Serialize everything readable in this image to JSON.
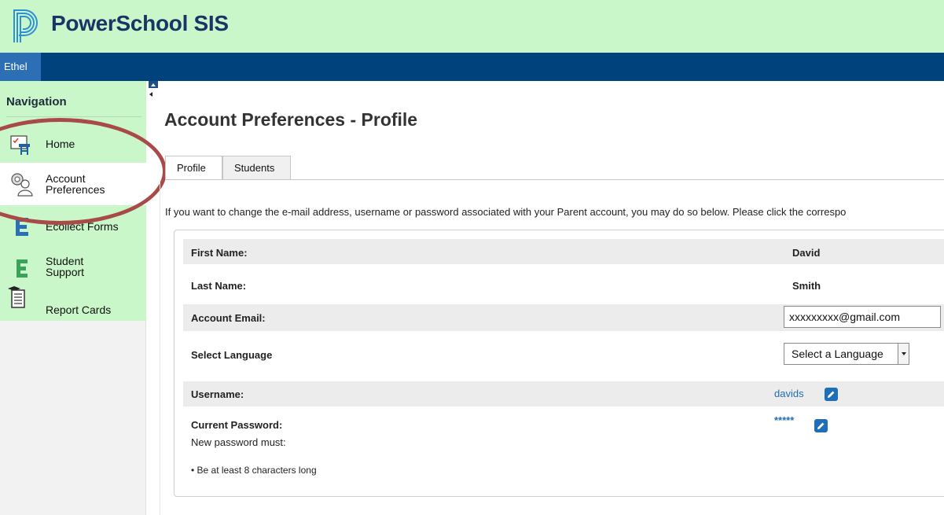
{
  "header": {
    "brand": "PowerSchool SIS"
  },
  "user_bar": {
    "user_name": "Ethel"
  },
  "sidebar": {
    "title": "Navigation",
    "items": [
      {
        "label": "Home",
        "icon": "home-icon"
      },
      {
        "label_line1": "Account",
        "label_line2": "Preferences",
        "icon": "account-preferences-icon",
        "active": true
      },
      {
        "label": "Ecollect Forms",
        "icon": "ecollect-forms-icon"
      },
      {
        "label_line1": "Student",
        "label_line2": "Support",
        "icon": "student-support-icon"
      },
      {
        "label": "Report Cards",
        "icon": "report-cards-icon"
      }
    ]
  },
  "main": {
    "title": "Account Preferences - Profile",
    "tabs": [
      {
        "label": "Profile",
        "active": true
      },
      {
        "label": "Students",
        "active": false
      }
    ],
    "intro": "If you want to change the e-mail address, username or password associated with your Parent account, you may do so below. Please click the correspo",
    "rows": {
      "first_name": {
        "label": "First Name:",
        "value": "David"
      },
      "last_name": {
        "label": "Last Name:",
        "value": "Smith"
      },
      "email": {
        "label": "Account Email:",
        "value": "xxxxxxxxx@gmail.com"
      },
      "language": {
        "label": "Select Language",
        "selected": "Select a Language"
      },
      "username": {
        "label": "Username:",
        "value": "davids"
      },
      "password": {
        "label": "Current Password:",
        "value": "*****",
        "rules_heading": "New password must:",
        "rules": [
          "• Be at least 8 characters long"
        ]
      }
    }
  },
  "colors": {
    "header_bg": "#c9f7c9",
    "nav_bar": "#00427c",
    "brand_text": "#1b3466",
    "link": "#1f6fb8",
    "annotation_oval": "#a84a48"
  }
}
